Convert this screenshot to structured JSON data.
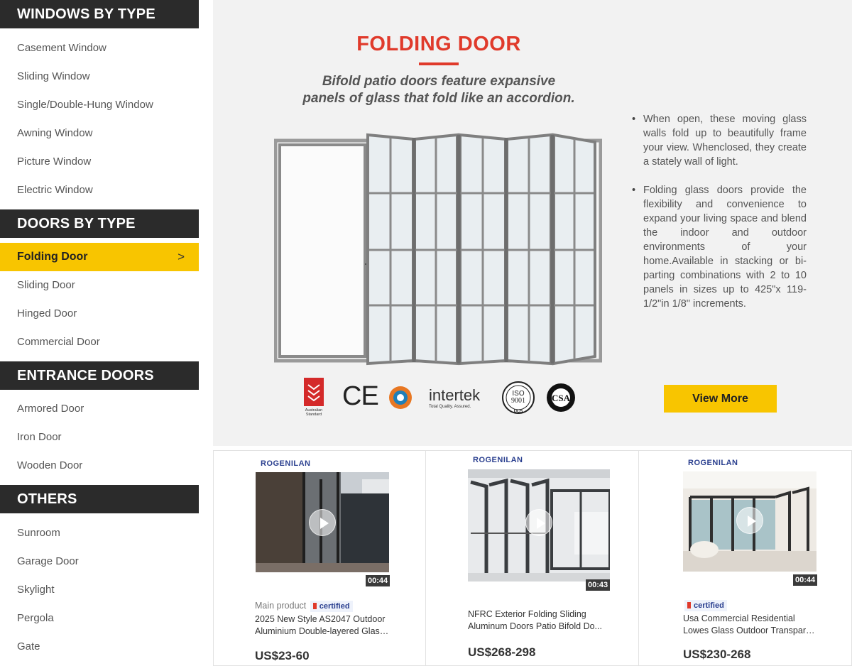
{
  "sidebar": {
    "sections": [
      {
        "title": "WINDOWS BY TYPE",
        "items": [
          "Casement Window",
          "Sliding Window",
          "Single/Double-Hung Window",
          "Awning Window",
          "Picture Window",
          "Electric Window"
        ]
      },
      {
        "title": "DOORS BY TYPE",
        "active_item": "Folding Door",
        "items": [
          "Sliding Door",
          "Hinged Door",
          "Commercial Door"
        ]
      },
      {
        "title": "ENTRANCE DOORS",
        "items": [
          "Armored Door",
          "Iron Door",
          "Wooden Door"
        ]
      },
      {
        "title": "OTHERS",
        "items": [
          "Sunroom",
          "Garage Door",
          "Skylight",
          "Pergola",
          "Gate"
        ]
      }
    ],
    "active_chevron": ">"
  },
  "feature": {
    "title": "FOLDING DOOR",
    "subtitle_line1": "Bifold patio doors feature expansive",
    "subtitle_line2": "panels of glass that fold like an accordion.",
    "bullets": [
      "When open, these moving glass walls fold up to beautifully frame your view. Whenclosed, they create a stately wall of light.",
      "Folding glass doors provide the flexibility and convenience to expand your living space and blend the indoor and outdoor environments of your home.Available in stacking or bi-parting combinations with 2 to 10 panels in sizes up to 425\"x 119-1/2\"in 1/8\" increments."
    ],
    "certifications": {
      "australian": "Australian Standard",
      "ce": "CE",
      "intertek": "intertek",
      "intertek_tagline": "Total Quality. Assured.",
      "iso": "ISO",
      "iso_number": "9001",
      "ucs": "UCS",
      "csa": "CSA"
    },
    "view_more_label": "View More"
  },
  "products": [
    {
      "brand": "ROGENILAN",
      "duration": "00:44",
      "tag": "Main product",
      "certified": "certified",
      "title_line1": "2025 New Style AS2047 Outdoor",
      "title_line2": "Aluminium Double-layered Glass...",
      "price": "US$23-60"
    },
    {
      "brand": "ROGENILAN",
      "duration": "00:43",
      "tag": "",
      "certified": "",
      "title_line1": "NFRC Exterior Folding Sliding",
      "title_line2": "Aluminum Doors Patio Bifold Do...",
      "price": "US$268-298"
    },
    {
      "brand": "ROGENILAN",
      "duration": "00:44",
      "tag": "",
      "certified": "certified",
      "title_line1": "Usa Commercial Residential",
      "title_line2": "Lowes Glass Outdoor Transpare...",
      "price": "US$230-268"
    }
  ],
  "colors": {
    "accent": "#f8c500",
    "title_red": "#e03a2b",
    "header_dark": "#2b2b2b"
  }
}
